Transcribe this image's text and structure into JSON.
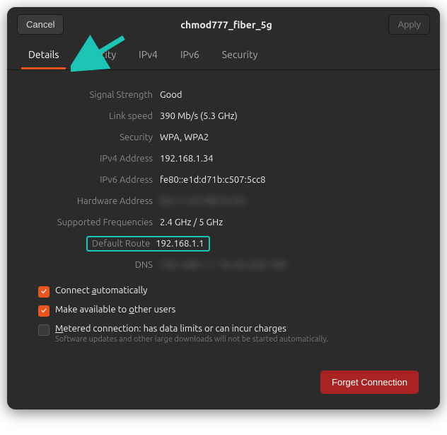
{
  "titlebar": {
    "cancel": "Cancel",
    "title": "chmod777_fiber_5g",
    "apply": "Apply"
  },
  "tabs": {
    "details": "Details",
    "identity": "Identity",
    "ipv4": "IPv4",
    "ipv6": "IPv6",
    "security": "Security"
  },
  "details": {
    "signal_strength_label": "Signal Strength",
    "signal_strength_value": "Good",
    "link_speed_label": "Link speed",
    "link_speed_value": "390 Mb/s (5.3 GHz)",
    "security_label": "Security",
    "security_value": "WPA, WPA2",
    "ipv4_label": "IPv4 Address",
    "ipv4_value": "192.168.1.34",
    "ipv6_label": "IPv6 Address",
    "ipv6_value": "fe80::e1d:d71b:c507:5cc8",
    "hw_label": "Hardware Address",
    "hw_value": "00:11:22:FB:33:44",
    "freq_label": "Supported Frequencies",
    "freq_value": "2.4 GHz / 5 GHz",
    "route_label": "Default Route",
    "route_value": "192.168.1.1",
    "dns_label": "DNS",
    "dns_value": "192.168.1.1  10.20.220.199"
  },
  "checkboxes": {
    "auto_pre": "Connect ",
    "auto_u": "a",
    "auto_post": "utomatically",
    "share_pre": "Make available to ",
    "share_u": "o",
    "share_post": "ther users",
    "metered_u": "M",
    "metered_post": "etered connection: has data limits or can incur charges",
    "metered_sub": "Software updates and other large downloads will not be started automatically."
  },
  "footer": {
    "forget": "Forget Connection"
  }
}
